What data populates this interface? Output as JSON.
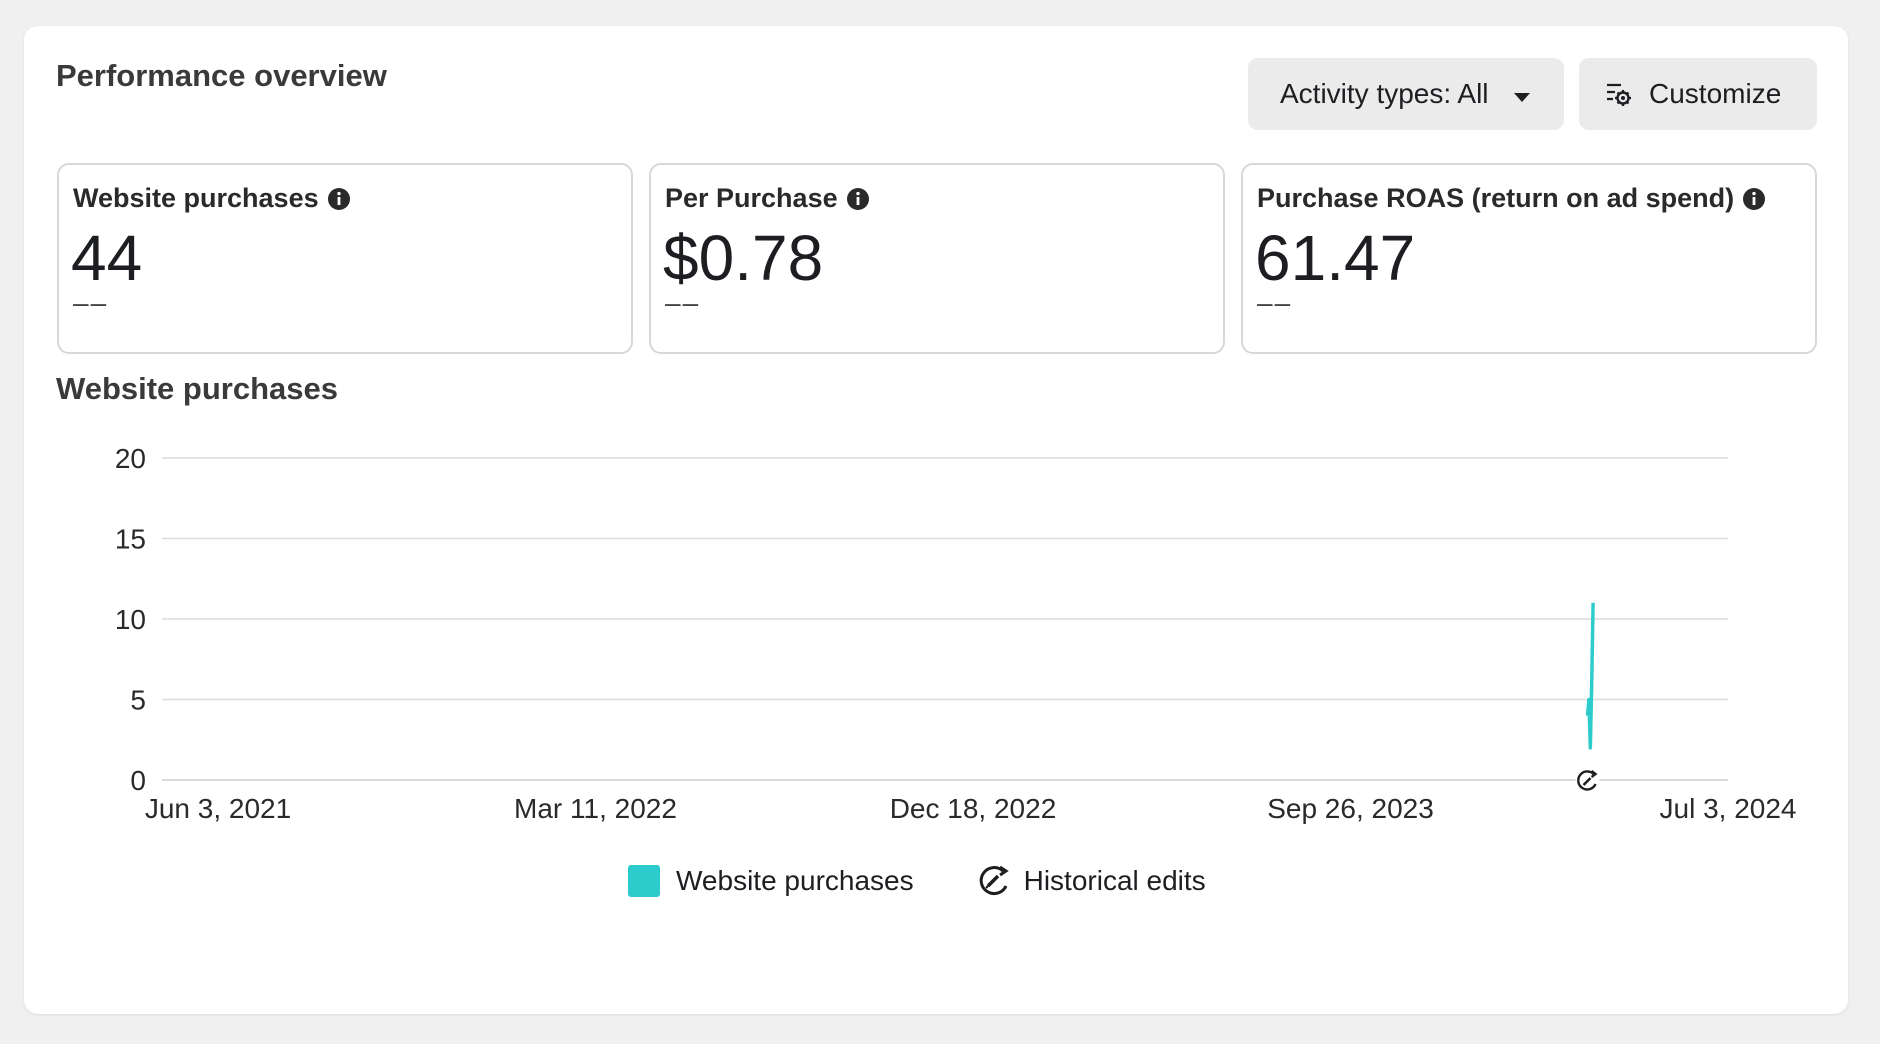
{
  "header": {
    "title": "Performance overview",
    "activity_button": "Activity types: All",
    "customize_button": "Customize"
  },
  "metrics": [
    {
      "label": "Website purchases",
      "value": "44",
      "delta": "––"
    },
    {
      "label": "Per Purchase",
      "value": "$0.78",
      "delta": "––"
    },
    {
      "label": "Purchase ROAS (return on ad spend)",
      "value": "61.47",
      "delta": "––"
    }
  ],
  "chart_section_title": "Website purchases",
  "chart_data": {
    "type": "line",
    "title": "Website purchases",
    "xlabel": "",
    "ylabel": "",
    "ylim": [
      0,
      20
    ],
    "y_ticks": [
      0,
      5,
      10,
      15,
      20
    ],
    "x_ticks": [
      "Jun 3, 2021",
      "Mar 11, 2022",
      "Dec 18, 2022",
      "Sep 26, 2023",
      "Jul 3, 2024"
    ],
    "x_range": [
      "2021-06-03",
      "2024-07-03"
    ],
    "grid": true,
    "series": [
      {
        "name": "Website purchases",
        "color": "#2ccccc",
        "points": [
          {
            "date": "2024-03-24",
            "value": 4
          },
          {
            "date": "2024-03-25",
            "value": 5
          },
          {
            "date": "2024-03-26",
            "value": 2
          },
          {
            "date": "2024-03-27",
            "value": 6
          },
          {
            "date": "2024-03-28",
            "value": 11
          }
        ]
      }
    ],
    "markers": [
      {
        "name": "Historical edits",
        "date": "2024-03-24",
        "icon": "historical-edit-icon"
      }
    ]
  },
  "legend": {
    "items": [
      {
        "label": "Website purchases",
        "color": "#2ccccc"
      },
      {
        "label": "Historical edits",
        "icon": "historical-edit-icon"
      }
    ]
  }
}
